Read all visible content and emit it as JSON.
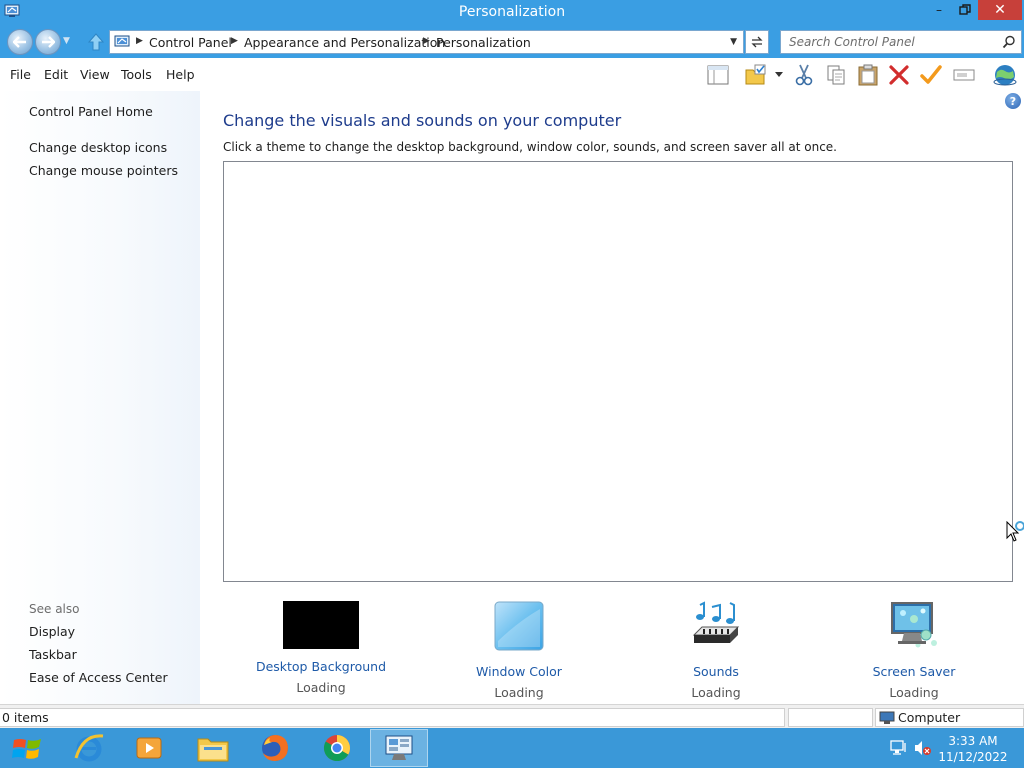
{
  "window": {
    "title": "Personalization",
    "minimize_label": "–",
    "maximize_label": "❐",
    "close_label": "✕"
  },
  "address_bar": {
    "breadcrumbs": [
      "Control Panel",
      "Appearance and Personalization",
      "Personalization"
    ],
    "search_placeholder": "Search Control Panel"
  },
  "menu": {
    "items": [
      "File",
      "Edit",
      "View",
      "Tools",
      "Help"
    ]
  },
  "toolbar_icons": [
    "layout-icon",
    "folder-check-icon",
    "dropdown-arrow-icon",
    "cut-icon",
    "copy-icon",
    "paste-icon",
    "delete-icon",
    "checkmark-icon",
    "rename-icon",
    "network-globe-icon"
  ],
  "sidebar": {
    "home_link": "Control Panel Home",
    "links": [
      "Change desktop icons",
      "Change mouse pointers"
    ],
    "see_also_label": "See also",
    "see_also_links": [
      "Display",
      "Taskbar",
      "Ease of Access Center"
    ]
  },
  "main": {
    "heading": "Change the visuals and sounds on your computer",
    "description": "Click a theme to change the desktop background, window color, sounds, and screen saver all at once.",
    "help_label": "?",
    "settings": [
      {
        "name": "Desktop Background",
        "status": "Loading",
        "icon": "desktop-background-thumb"
      },
      {
        "name": "Window Color",
        "status": "Loading",
        "icon": "window-color-icon"
      },
      {
        "name": "Sounds",
        "status": "Loading",
        "icon": "sounds-icon"
      },
      {
        "name": "Screen Saver",
        "status": "Loading",
        "icon": "screen-saver-icon"
      }
    ]
  },
  "status_bar": {
    "items_count": "0 items",
    "location": "Computer"
  },
  "taskbar": {
    "apps": [
      "internet-explorer-icon",
      "media-player-icon",
      "file-explorer-icon",
      "firefox-icon",
      "chrome-icon",
      "control-panel-icon"
    ],
    "active_app": "control-panel-icon",
    "time": "3:33 AM",
    "date": "11/12/2022"
  },
  "colors": {
    "title_bar": "#3a9ee3",
    "taskbar": "#3a98d8",
    "link": "#1e5aa8",
    "heading": "#1e3c8c",
    "close_button": "#c7403a"
  }
}
